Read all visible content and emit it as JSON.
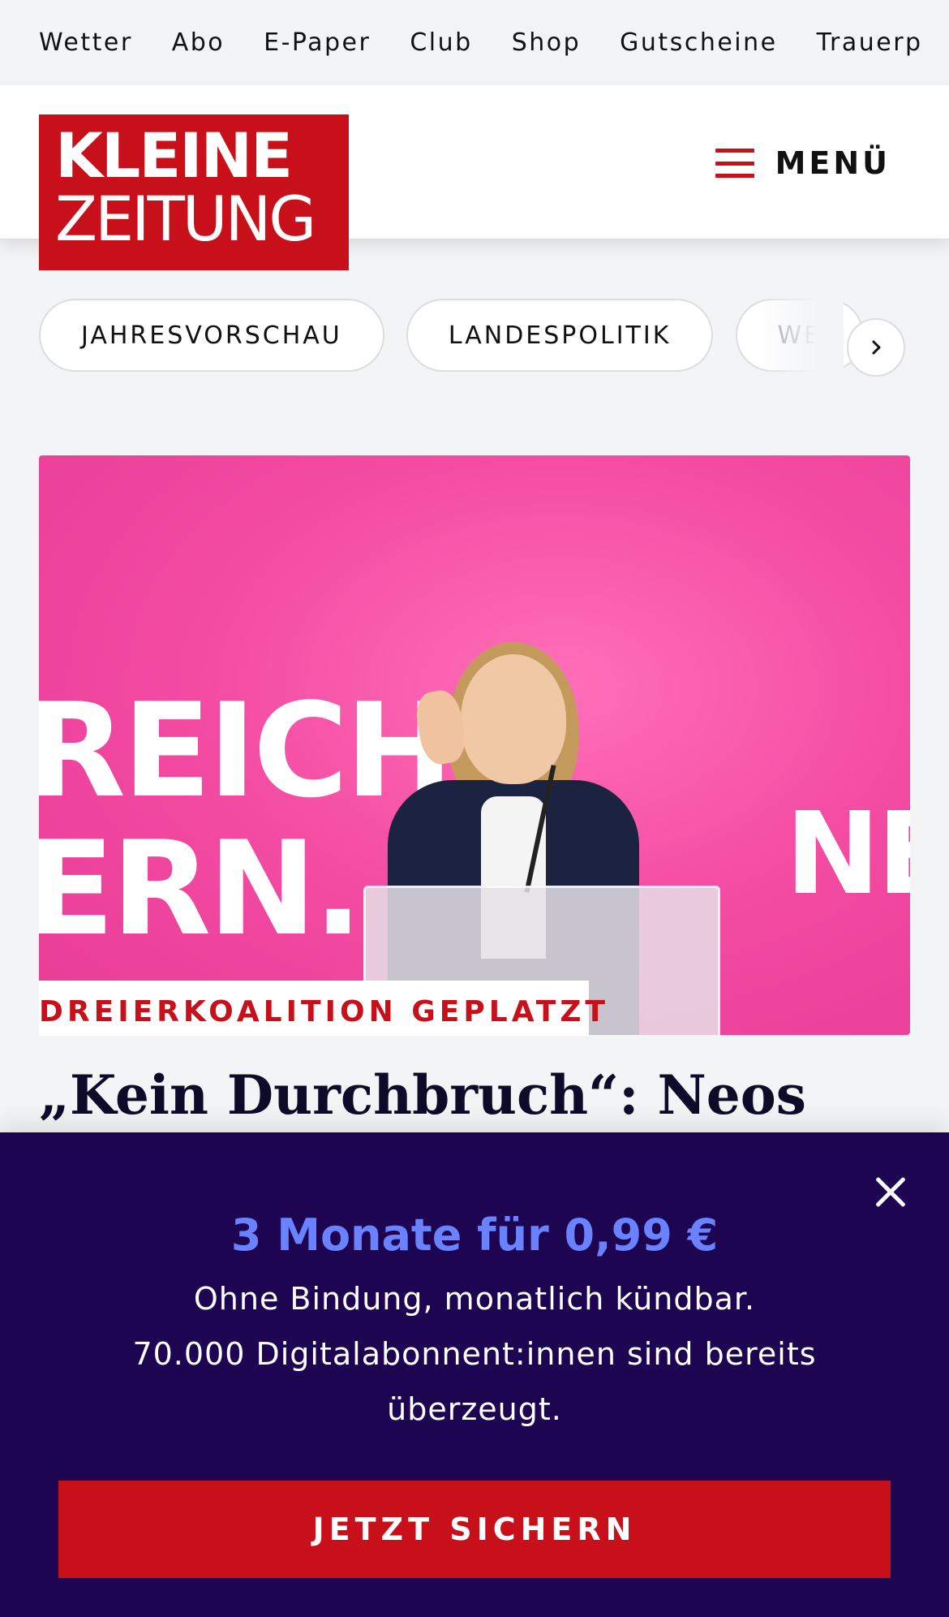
{
  "service_nav": [
    "Wetter",
    "Abo",
    "E-Paper",
    "Club",
    "Shop",
    "Gutscheine",
    "Trauerp"
  ],
  "header": {
    "logo_line1": "KLEINE",
    "logo_line2": "ZEITUNG",
    "menu_label": "MENÜ"
  },
  "topics": [
    "JAHRESVORSCHAU",
    "LANDESPOLITIK",
    "WE"
  ],
  "article": {
    "kicker": "DREIERKOALITION GEPLATZT",
    "headline": "„Kein Durchbruch“: Neos",
    "image_text": {
      "line1": "REICH",
      "line2": "ERN.",
      "line3": "NE"
    }
  },
  "paywall": {
    "offer": "3 Monate für 0,99 €",
    "line1": "Ohne Bindung, monatlich kündbar.",
    "line2": "70.000 Digitalabonnent:innen sind bereits",
    "line3": "überzeugt.",
    "cta": "JETZT SICHERN"
  },
  "colors": {
    "brand_red": "#c8101a",
    "paywall_bg": "#1e0552",
    "offer_blue": "#6b82ff",
    "hero_pink": "#f34aa2"
  }
}
